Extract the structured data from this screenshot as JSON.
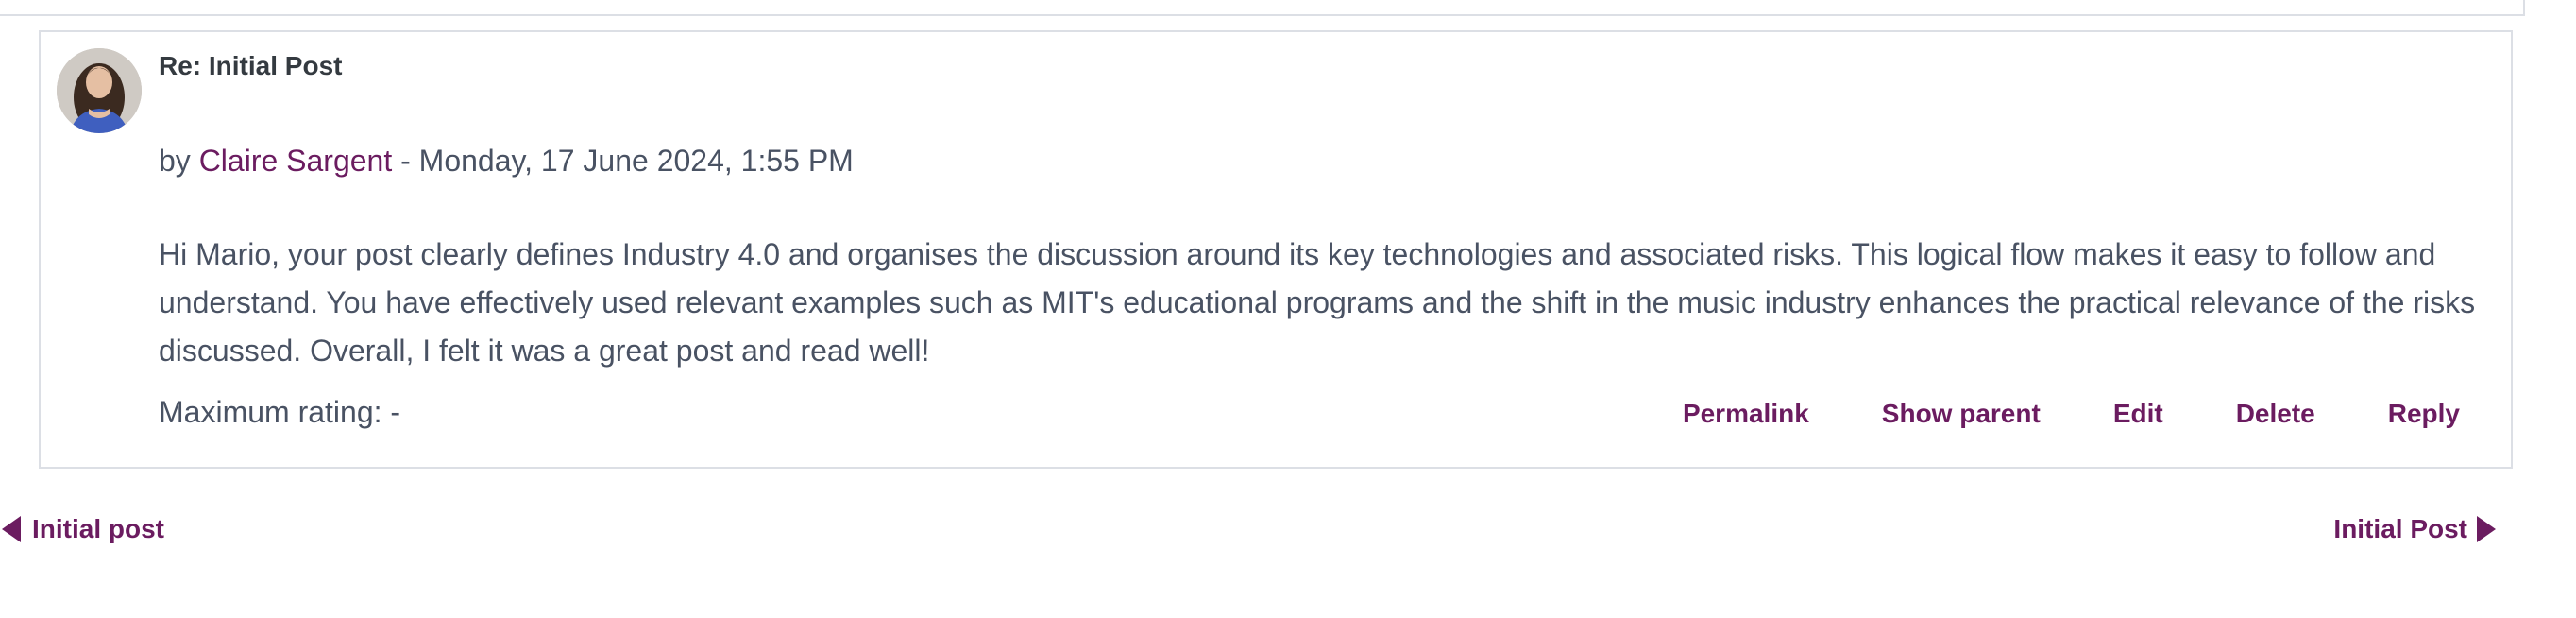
{
  "post": {
    "subject": "Re: Initial Post",
    "by_prefix": "by",
    "author": "Claire Sargent",
    "date": " - Monday, 17 June 2024, 1:55 PM",
    "body": "Hi Mario, your post clearly defines Industry 4.0 and organises the discussion around its key technologies and associated risks. This logical flow makes it easy to follow and understand. You have effectively used relevant examples such as MIT's educational programs and the shift in the music industry enhances the practical relevance of the risks discussed. Overall, I felt it was a great post and read well!",
    "rating": "Maximum rating: -",
    "actions": {
      "permalink": "Permalink",
      "show_parent": "Show parent",
      "edit": "Edit",
      "delete": "Delete",
      "reply": "Reply"
    }
  },
  "navigation": {
    "prev_label": "Initial post",
    "next_label": "Initial Post"
  },
  "colors": {
    "link": "#6b1c60",
    "text": "#495263",
    "border": "#dcdfe5"
  }
}
